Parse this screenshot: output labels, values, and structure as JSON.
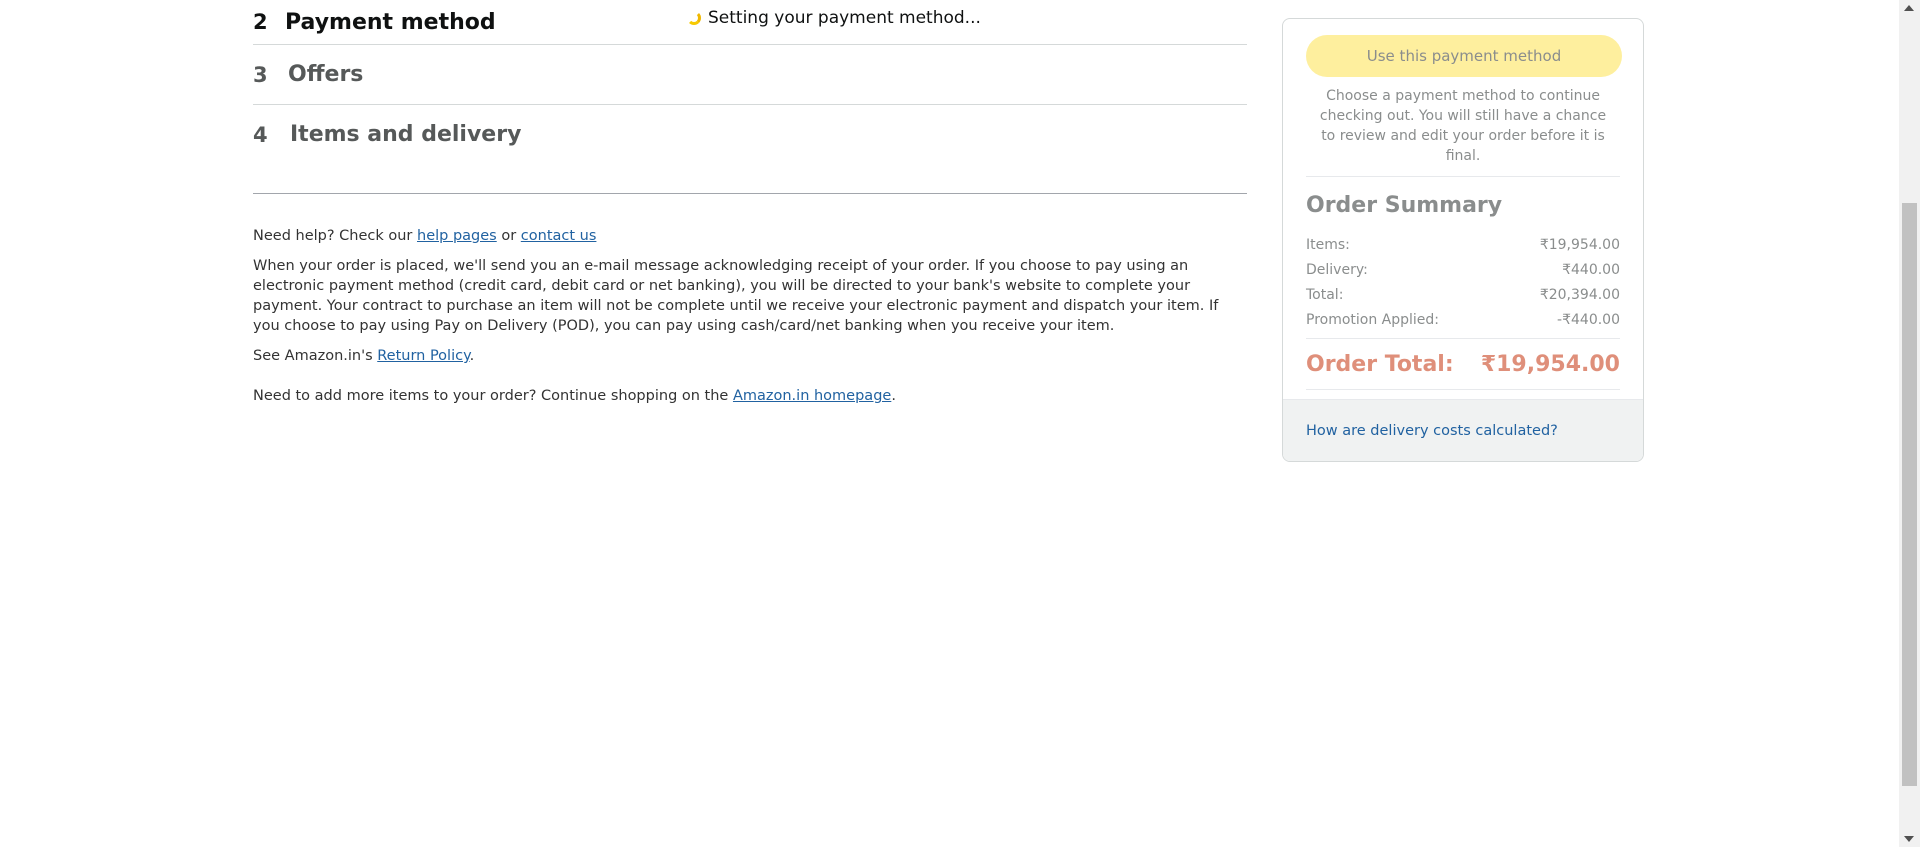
{
  "steps": [
    {
      "num": "2",
      "title": "Payment method"
    },
    {
      "num": "3",
      "title": "Offers"
    },
    {
      "num": "4",
      "title": "Items and delivery"
    }
  ],
  "status_text": "Setting your payment method...",
  "help": {
    "prefix": "Need help? Check our ",
    "help_pages": "help pages",
    "or": " or ",
    "contact_us": "contact us",
    "paragraph": "When your order is placed, we'll send you an e-mail message acknowledging receipt of your order. If you choose to pay using an electronic payment method (credit card, debit card or net banking), you will be directed to your bank's website to complete your payment. Your contract to purchase an item will not be complete until we receive your electronic payment and dispatch your item. If you choose to pay using Pay on Delivery (POD), you can pay using cash/card/net banking when you receive your item.",
    "return_prefix": "See Amazon.in's ",
    "return_policy": "Return Policy",
    "period": ".",
    "continue_prefix": "Need to add more items to your order? Continue shopping on the ",
    "homepage": "Amazon.in homepage",
    "continue_period": "."
  },
  "summary": {
    "button": "Use this payment method",
    "note": "Choose a payment method to continue checking out. You will still have a chance to review and edit your order before it is final.",
    "title": "Order Summary",
    "rows": [
      {
        "label": "Items:",
        "value": "₹19,954.00"
      },
      {
        "label": "Delivery:",
        "value": "₹440.00"
      },
      {
        "label": "Total:",
        "value": "₹20,394.00"
      },
      {
        "label": "Promotion Applied:",
        "value": "-₹440.00"
      }
    ],
    "total_label": "Order Total:",
    "total_value": "₹19,954.00",
    "footer_link": "How are delivery costs calculated?"
  },
  "colors": {
    "link": "#2162a1",
    "button_disabled": "#feef9e",
    "order_total": "#df8f7a",
    "spinner": "#f7ca00"
  },
  "icons": {
    "spinner": "loading-spinner-icon",
    "scroll_up": "scroll-up-arrow-icon",
    "scroll_down": "scroll-down-arrow-icon"
  }
}
